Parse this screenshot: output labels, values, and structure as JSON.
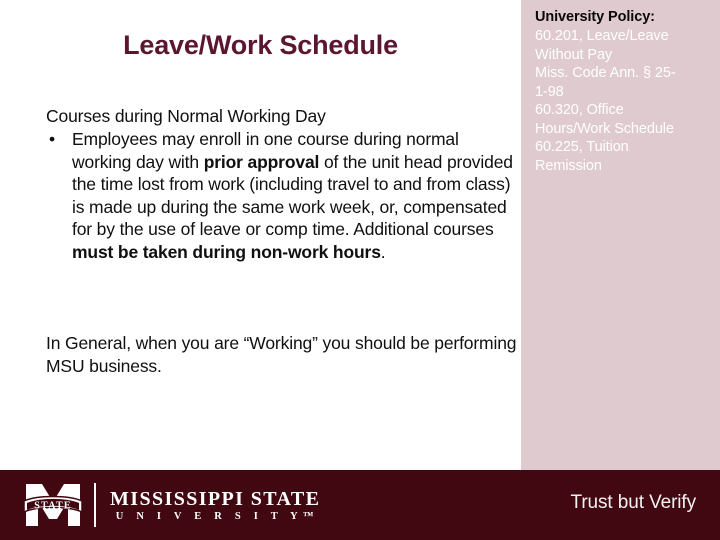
{
  "slide": {
    "title": "Leave/Work Schedule"
  },
  "content": {
    "lead_line": "Courses during Normal Working Day",
    "bullet_marker": "•",
    "bullet_parts": {
      "p1": "Employees may enroll in one course during normal working day with ",
      "b1": "prior approval",
      "p2": " of the unit head provided the time lost from work (including travel to and from class) is made up during the same work week, or, compensated for by the use of leave or comp time. Additional courses ",
      "b2": "must be taken during non-work hours",
      "p3": "."
    },
    "general_note": "In General, when you are  “Working”  you should be performing MSU business."
  },
  "policy": {
    "heading": "University Policy:",
    "lines": [
      "60.201, Leave/Leave",
      "Without Pay",
      "Miss. Code Ann. § 25-",
      "1-98",
      "60.320, Office",
      "Hours/Work Schedule",
      "60.225, Tuition",
      "Remission"
    ]
  },
  "footer": {
    "logo_banner_text": "STATE",
    "wordmark_main": "MISSISSIPPI STATE",
    "wordmark_sub": "U N I V E R S I T Y™",
    "tagline": "Trust but Verify"
  },
  "colors": {
    "title_maroon": "#5b1630",
    "footer_maroon": "#410811",
    "panel_pink": "#dfcacf",
    "body_text": "#101010",
    "white": "#ffffff"
  }
}
